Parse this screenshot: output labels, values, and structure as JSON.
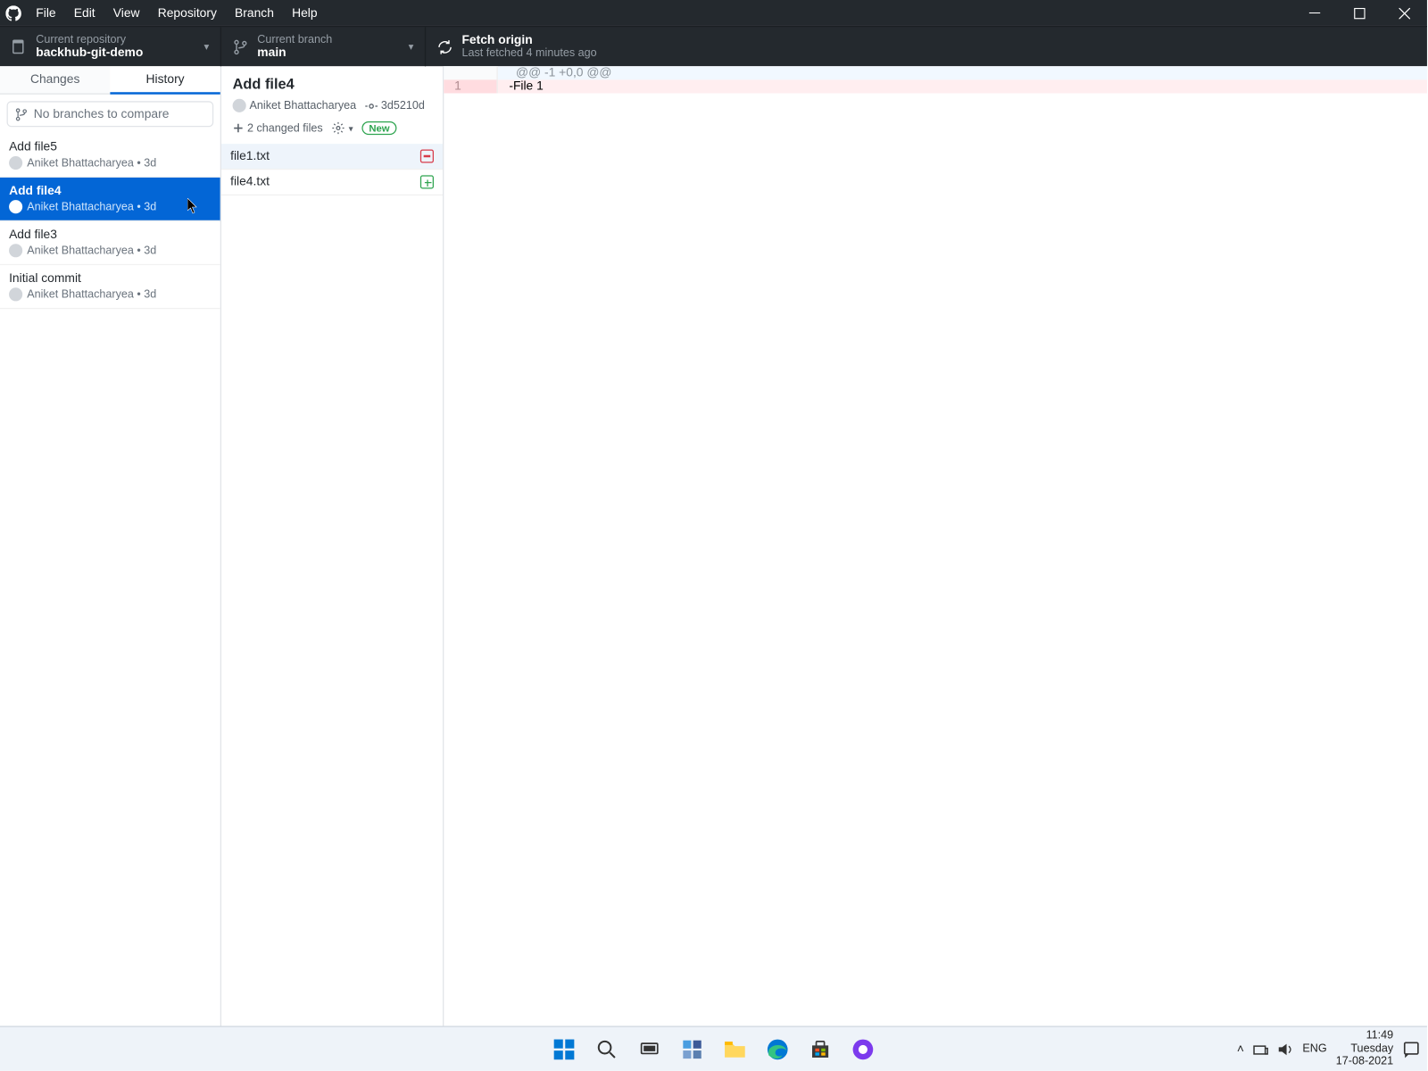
{
  "menu": {
    "items": [
      "File",
      "Edit",
      "View",
      "Repository",
      "Branch",
      "Help"
    ]
  },
  "toolbar": {
    "repo": {
      "label": "Current repository",
      "value": "backhub-git-demo"
    },
    "branch": {
      "label": "Current branch",
      "value": "main"
    },
    "fetch": {
      "label": "Fetch origin",
      "sub": "Last fetched 4 minutes ago"
    }
  },
  "tabs": {
    "changes": "Changes",
    "history": "History"
  },
  "compare_placeholder": "No branches to compare",
  "commits": [
    {
      "title": "Add file5",
      "author": "Aniket Bhattacharyea",
      "time": "3d",
      "selected": false
    },
    {
      "title": "Add file4",
      "author": "Aniket Bhattacharyea",
      "time": "3d",
      "selected": true
    },
    {
      "title": "Add file3",
      "author": "Aniket Bhattacharyea",
      "time": "3d",
      "selected": false
    },
    {
      "title": "Initial commit",
      "author": "Aniket Bhattacharyea",
      "time": "3d",
      "selected": false
    }
  ],
  "detail": {
    "title": "Add file4",
    "author": "Aniket Bhattacharyea",
    "sha": "3d5210d",
    "changed": "2 changed files",
    "badge": "New"
  },
  "files": [
    {
      "name": "file1.txt",
      "status": "del",
      "selected": true
    },
    {
      "name": "file4.txt",
      "status": "add",
      "selected": false
    }
  ],
  "diff": {
    "hunk": "@@ -1 +0,0 @@",
    "lines": [
      {
        "old": "1",
        "new": "",
        "text": "-File 1",
        "type": "del"
      }
    ]
  },
  "tray": {
    "lang": "ENG",
    "time": "11:49",
    "day": "Tuesday",
    "date": "17-08-2021"
  }
}
